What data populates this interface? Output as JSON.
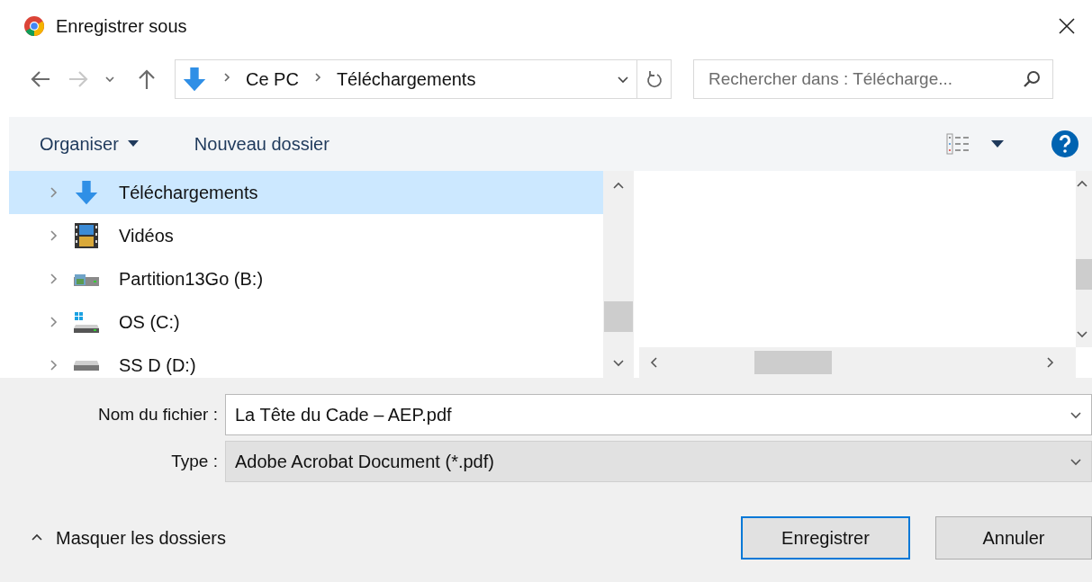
{
  "window": {
    "title": "Enregistrer sous"
  },
  "nav": [
    {
      "kind": "back",
      "disabled": false
    },
    {
      "kind": "forward",
      "disabled": true
    },
    {
      "kind": "recent",
      "disabled": false
    },
    {
      "kind": "up",
      "disabled": false
    }
  ],
  "address_bar": {
    "path": [
      "Ce PC",
      "Téléchargements"
    ]
  },
  "search": {
    "placeholder": "Rechercher dans : Télécharge..."
  },
  "toolbar": {
    "organise": "Organiser",
    "new_folder": "Nouveau dossier"
  },
  "tree": [
    {
      "label": "Téléchargements",
      "kind": "downloads",
      "selected": true
    },
    {
      "label": "Vidéos",
      "kind": "videos",
      "selected": false
    },
    {
      "label": "Partition13Go (B:)",
      "kind": "drive-picture",
      "selected": false
    },
    {
      "label": "OS (C:)",
      "kind": "drive-windows",
      "selected": false
    },
    {
      "label": "SS D (D:)",
      "kind": "drive",
      "selected": false
    }
  ],
  "form": {
    "filename_label": "Nom du fichier :",
    "filename": "La Tête du Cade – AEP.pdf",
    "type_label": "Type :",
    "type": "Adobe Acrobat Document (*.pdf)"
  },
  "hide_folders": "Masquer les dossiers",
  "buttons": [
    {
      "label": "Enregistrer",
      "default": true
    },
    {
      "label": "Annuler",
      "default": false
    }
  ]
}
